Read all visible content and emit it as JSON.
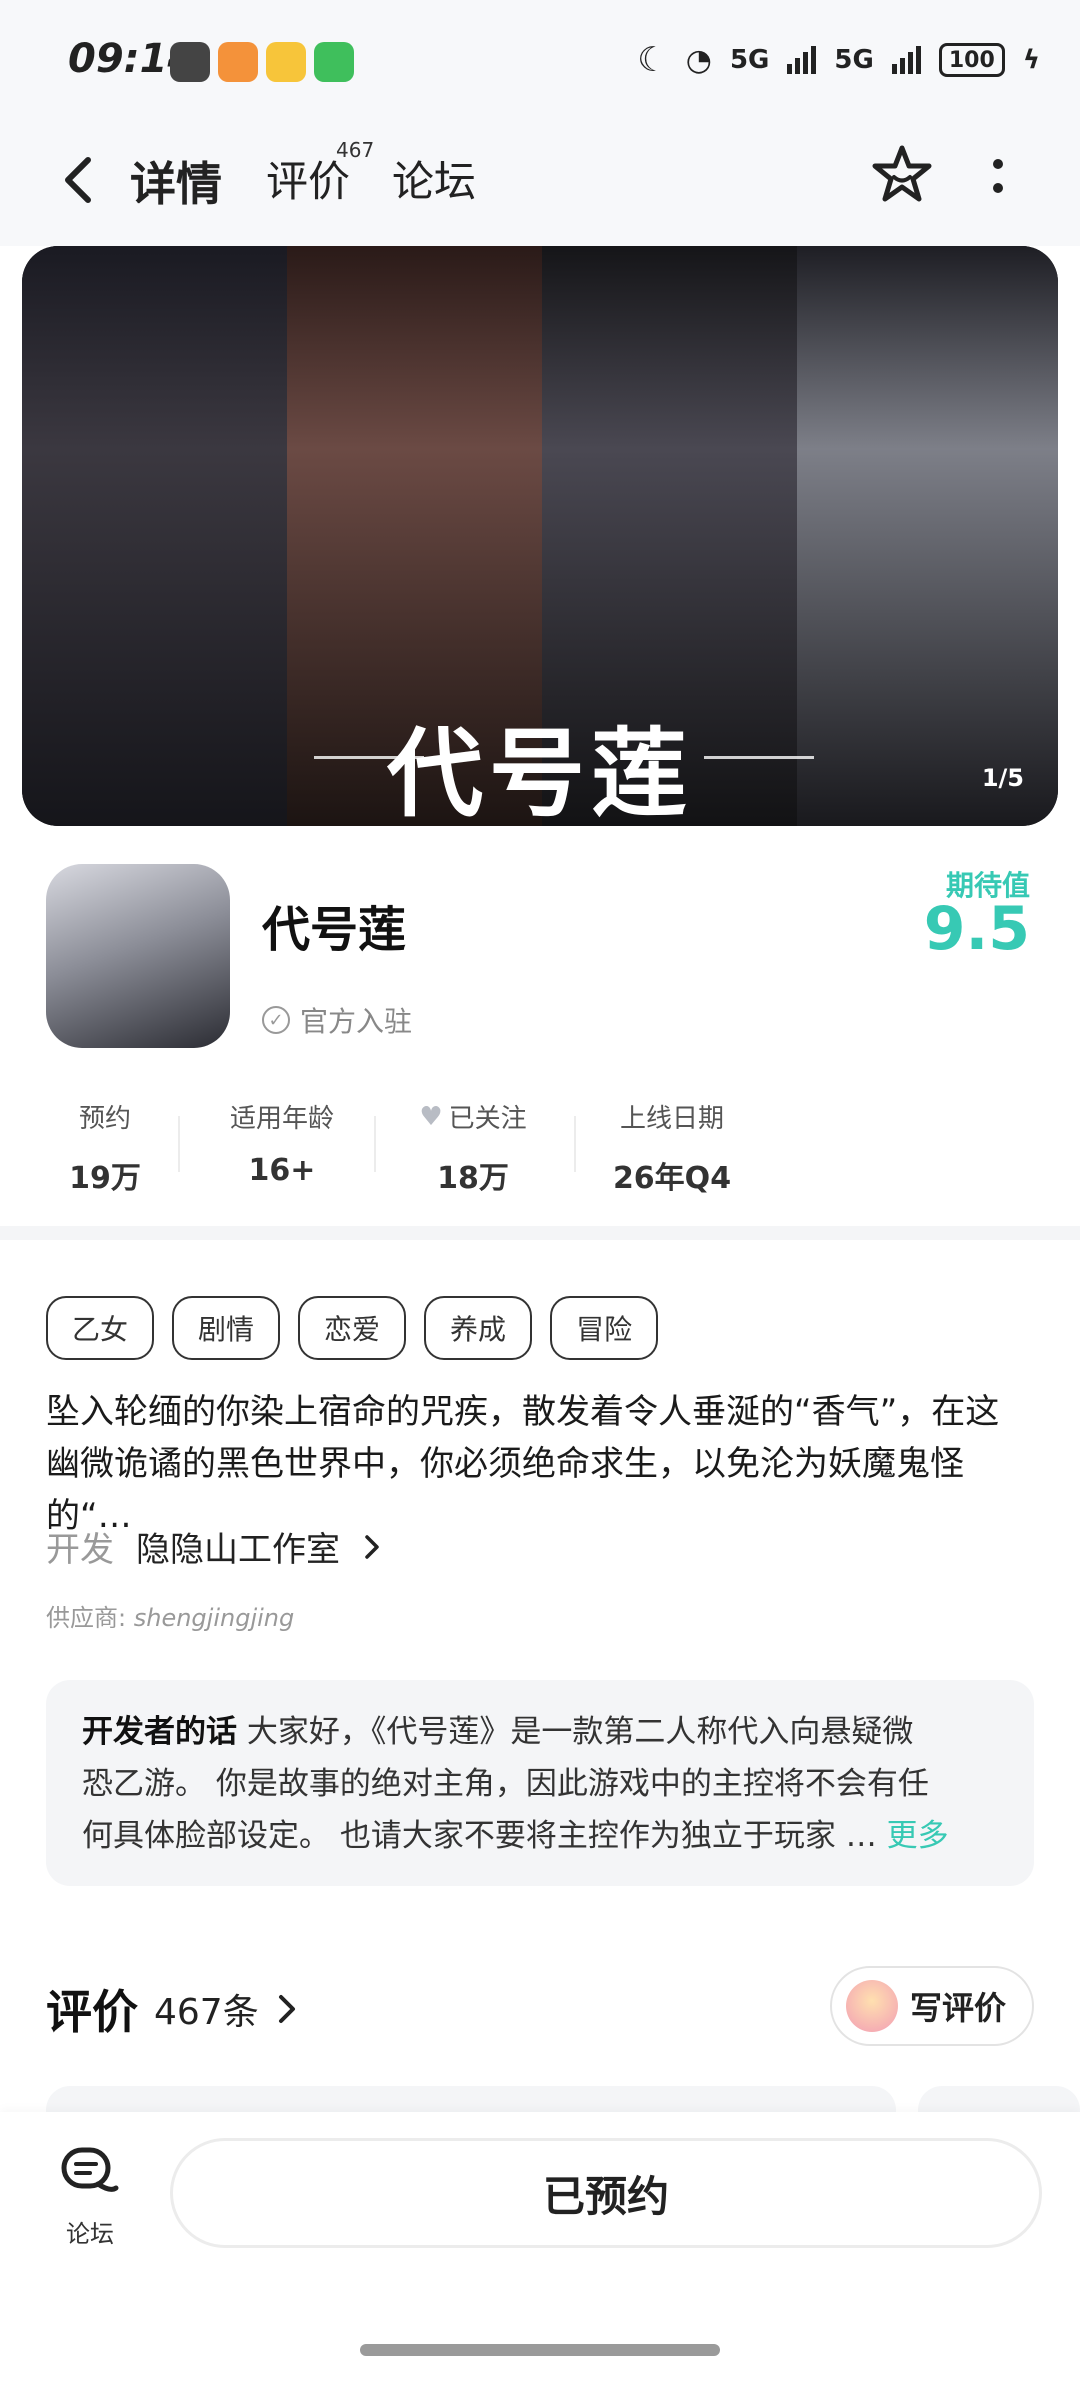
{
  "status_bar": {
    "time": "09:14",
    "network_1": "5G",
    "network_2": "5G",
    "battery": "100",
    "icons": [
      "clock-app-icon",
      "orange-app-icon",
      "weibo-icon",
      "wechat-icon",
      "moon-icon",
      "wifi-icon",
      "signal-icon",
      "charging-icon"
    ]
  },
  "header": {
    "tabs": [
      {
        "label": "详情",
        "active": true
      },
      {
        "label": "评价",
        "badge": "467"
      },
      {
        "label": "论坛"
      }
    ]
  },
  "banner": {
    "title": "代号莲",
    "counter": "1/5"
  },
  "game": {
    "name": "代号莲",
    "official_label": "官方入驻",
    "expect_label": "期待值",
    "expect_score": "9.5"
  },
  "stats": [
    {
      "label": "预约",
      "value": "19万"
    },
    {
      "label": "适用年龄",
      "value": "16+"
    },
    {
      "label": "已关注",
      "value": "18万"
    },
    {
      "label": "上线日期",
      "value": "26年Q4"
    }
  ],
  "tags": [
    "乙女",
    "剧情",
    "恋爱",
    "养成",
    "冒险"
  ],
  "description": {
    "line1": "坠入轮缅的你染上宿命的咒疾，散发着令人垂涎的“香气”，在这",
    "line2": "幽微诡谲的黑色世界中，你必须绝命求生，以免沦为妖魔鬼怪的“…"
  },
  "developer": {
    "label": "开发",
    "name": "隐隐山工作室",
    "supplier_label": "供应商:",
    "supplier_name": "shengjingjing"
  },
  "dev_note": {
    "title": "开发者的话",
    "line1": "大家好，《代号莲》是一款第二人称代入向悬疑微",
    "line2": "恐乙游。 你是故事的绝对主角，因此游戏中的主控将不会有任",
    "line3": "何具体脸部设定。 也请大家不要将主控作为独立于玩家 …",
    "more": "更多"
  },
  "reviews": {
    "title": "评价",
    "count": "467条",
    "write_label": "写评价"
  },
  "bottom_bar": {
    "forum_label": "论坛",
    "reserve_label": "已预约"
  },
  "colors": {
    "accent": "#37c9b4",
    "background": "#ffffff",
    "header_bg": "#f7f8fa"
  }
}
